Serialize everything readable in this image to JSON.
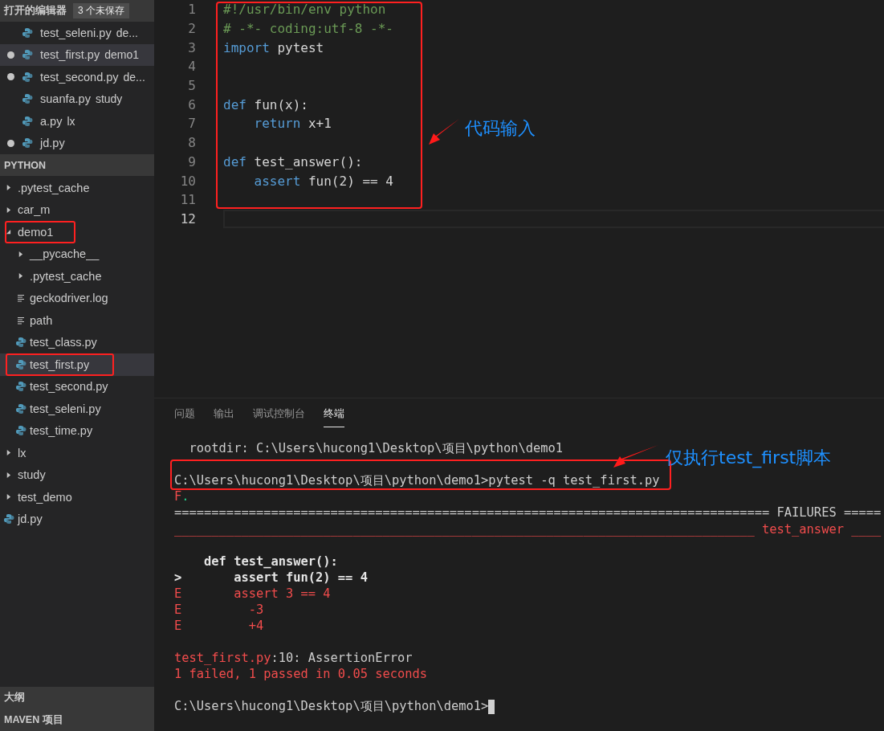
{
  "open_editors": {
    "title": "打开的编辑器",
    "badge": "3 个未保存",
    "items": [
      {
        "name": "test_seleni.py",
        "description": "de...",
        "dirty": false,
        "selected": false
      },
      {
        "name": "test_first.py",
        "description": "demo1",
        "dirty": true,
        "selected": true
      },
      {
        "name": "test_second.py",
        "description": "de...",
        "dirty": true,
        "selected": false
      },
      {
        "name": "suanfa.py",
        "description": "study",
        "dirty": false,
        "selected": false
      },
      {
        "name": "a.py",
        "description": "lx",
        "dirty": false,
        "selected": false
      },
      {
        "name": "jd.py",
        "dirty": true,
        "selected": false
      }
    ]
  },
  "explorer": {
    "title": "PYTHON",
    "tree": [
      {
        "label": ".pytest_cache",
        "kind": "folder",
        "expanded": false,
        "selected": false,
        "boxed": false
      },
      {
        "label": "car_m",
        "kind": "folder",
        "expanded": false,
        "selected": false,
        "boxed": false
      },
      {
        "label": "demo1",
        "kind": "folder",
        "expanded": true,
        "selected": false,
        "boxed": true,
        "children": [
          {
            "label": "__pycache__",
            "kind": "folder",
            "expanded": false,
            "selected": false,
            "boxed": false
          },
          {
            "label": ".pytest_cache",
            "kind": "folder",
            "expanded": false,
            "selected": false,
            "boxed": false
          },
          {
            "label": "geckodriver.log",
            "kind": "text",
            "selected": false,
            "boxed": false
          },
          {
            "label": "path",
            "kind": "text",
            "selected": false,
            "boxed": false
          },
          {
            "label": "test_class.py",
            "kind": "python",
            "selected": false,
            "boxed": false
          },
          {
            "label": "test_first.py",
            "kind": "python",
            "selected": true,
            "boxed": true
          },
          {
            "label": "test_second.py",
            "kind": "python",
            "selected": false,
            "boxed": false
          },
          {
            "label": "test_seleni.py",
            "kind": "python",
            "selected": false,
            "boxed": false
          },
          {
            "label": "test_time.py",
            "kind": "python",
            "selected": false,
            "boxed": false
          }
        ]
      },
      {
        "label": "lx",
        "kind": "folder",
        "expanded": false,
        "selected": false,
        "boxed": false
      },
      {
        "label": "study",
        "kind": "folder",
        "expanded": false,
        "selected": false,
        "boxed": false
      },
      {
        "label": "test_demo",
        "kind": "folder",
        "expanded": false,
        "selected": false,
        "boxed": false
      },
      {
        "label": "jd.py",
        "kind": "python",
        "selected": false,
        "boxed": false
      }
    ]
  },
  "bottom_sections": [
    "大纲",
    "MAVEN 项目"
  ],
  "editor": {
    "boxed": true,
    "lines": [
      {
        "number": "1",
        "current": false,
        "tokens": [
          {
            "t": "#!/usr/bin/env python",
            "kind": "comment"
          }
        ]
      },
      {
        "number": "2",
        "current": false,
        "tokens": [
          {
            "t": "# -*- coding:utf-8 -*-",
            "kind": "comment"
          }
        ]
      },
      {
        "number": "3",
        "current": false,
        "tokens": [
          {
            "t": "import",
            "kind": "keyword"
          },
          {
            "t": " pytest",
            "kind": "text"
          }
        ]
      },
      {
        "number": "4",
        "current": false
      },
      {
        "number": "5",
        "current": false
      },
      {
        "number": "6",
        "current": false,
        "tokens": [
          {
            "t": "def",
            "kind": "keyword"
          },
          {
            "t": " fun(x):",
            "kind": "text"
          }
        ]
      },
      {
        "number": "7",
        "current": false,
        "tokens": [
          {
            "t": "    return",
            "kind": "keyword"
          },
          {
            "t": " x+1",
            "kind": "text"
          }
        ]
      },
      {
        "number": "8",
        "current": false
      },
      {
        "number": "9",
        "current": false,
        "tokens": [
          {
            "t": "def",
            "kind": "keyword"
          },
          {
            "t": " test_answer():",
            "kind": "text"
          }
        ]
      },
      {
        "number": "10",
        "current": false,
        "tokens": [
          {
            "t": "    assert",
            "kind": "keyword"
          },
          {
            "t": " fun(2) == 4",
            "kind": "text"
          }
        ]
      },
      {
        "number": "11",
        "current": false
      },
      {
        "number": "12",
        "current": true
      }
    ],
    "callout": "代码输入"
  },
  "panel": {
    "callout": "仅执行test_first脚本",
    "tabs": [
      {
        "label": "问题",
        "selected": false
      },
      {
        "label": "输出",
        "selected": false
      },
      {
        "label": "调试控制台",
        "selected": false
      },
      {
        "label": "终端",
        "selected": true
      }
    ],
    "terminal": {
      "cursor": true,
      "lines": [
        {
          "boxed": false,
          "segments": [
            {
              "t": "  rootdir: C:\\Users\\hucong1\\Desktop\\项目\\python\\demo1",
              "kind": "text"
            }
          ]
        },
        {
          "boxed": false
        },
        {
          "boxed": true,
          "segments": [
            {
              "t": "C:\\Users\\hucong1\\Desktop\\项目\\python\\demo1>pytest -q test_first.py",
              "kind": "text"
            }
          ]
        },
        {
          "boxed": false,
          "segments": [
            {
              "t": "F",
              "kind": "error"
            },
            {
              "t": ".",
              "kind": "pass"
            }
          ]
        },
        {
          "boxed": false,
          "segments": [
            {
              "t": "================================================================================ FAILURES =====",
              "kind": "text"
            }
          ]
        },
        {
          "boxed": false,
          "segments": [
            {
              "t": "______________________________________________________________________________ test_answer ____",
              "kind": "error"
            }
          ]
        },
        {
          "boxed": false
        },
        {
          "boxed": false,
          "segments": [
            {
              "t": "    def test_answer():",
              "kind": "bold"
            }
          ]
        },
        {
          "boxed": false,
          "segments": [
            {
              "t": ">       assert fun(2) == 4",
              "kind": "bold"
            }
          ]
        },
        {
          "boxed": false,
          "segments": [
            {
              "t": "E       assert 3 == 4",
              "kind": "error"
            }
          ]
        },
        {
          "boxed": false,
          "segments": [
            {
              "t": "E         -3",
              "kind": "error"
            }
          ]
        },
        {
          "boxed": false,
          "segments": [
            {
              "t": "E         +4",
              "kind": "error"
            }
          ]
        },
        {
          "boxed": false
        },
        {
          "boxed": false,
          "segments": [
            {
              "t": "test_first.py",
              "kind": "error"
            },
            {
              "t": ":10: AssertionError",
              "kind": "text"
            }
          ]
        },
        {
          "boxed": false,
          "segments": [
            {
              "t": "1 failed, 1 passed in 0.05 seconds",
              "kind": "error"
            }
          ]
        },
        {
          "boxed": false
        },
        {
          "boxed": false,
          "segments": [
            {
              "t": "C:\\Users\\hucong1\\Desktop\\项目\\python\\demo1>",
              "kind": "text"
            }
          ]
        }
      ]
    }
  }
}
